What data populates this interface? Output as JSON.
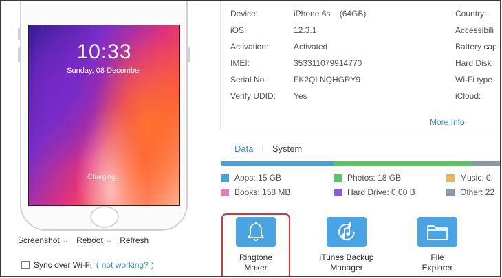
{
  "phone": {
    "time": "10:33",
    "date": "Sunday, 08 December",
    "charging": "Charging..."
  },
  "phone_actions": {
    "screenshot": "Screenshot",
    "reboot": "Reboot",
    "refresh": "Refresh"
  },
  "sync": {
    "label": "Sync over Wi-Fi",
    "paren_open": "(",
    "link": "not working?",
    "paren_close": ")",
    "checked": false
  },
  "info": {
    "rows": [
      {
        "label": "Device:",
        "value": "iPhone 6s    (64GB)",
        "right_label": "Country:"
      },
      {
        "label": "iOS:",
        "value": "12.3.1",
        "right_label": "Accessibili"
      },
      {
        "label": "Activation:",
        "value": "Activated",
        "right_label": "Battery cap"
      },
      {
        "label": "IMEI:",
        "value": "353311079914770",
        "right_label": "Hard Disk"
      },
      {
        "label": "Serial No.:",
        "value": "FK2QLNQHGRY9",
        "right_label": "Wi-Fi type"
      },
      {
        "label": "Verify UDID:",
        "value": "Yes",
        "right_label": "iCloud:"
      }
    ],
    "more_info": "More Info"
  },
  "tabs": {
    "data": "Data",
    "system": "System"
  },
  "storage": {
    "colors": {
      "apps": "#4a9fd8",
      "photos": "#5cc561",
      "music": "#e8b561",
      "books": "#e27fbe",
      "hard_drive": "#8b5ad6",
      "other": "#8a9aa8"
    },
    "legend": {
      "apps": "Apps: 15 GB",
      "photos": "Photos: 18 GB",
      "music": "Music: 0.",
      "books": "Books: 158 MB",
      "hard_drive": "Hard Drive: 0.00 B",
      "other": "Other: 22"
    }
  },
  "tools": [
    {
      "line1": "Ringtone",
      "line2": "Maker",
      "icon": "bell-icon"
    },
    {
      "line1": "iTunes Backup",
      "line2": "Manager",
      "icon": "music-sync-icon"
    },
    {
      "line1": "File",
      "line2": "Explorer",
      "icon": "folder-icon"
    }
  ]
}
